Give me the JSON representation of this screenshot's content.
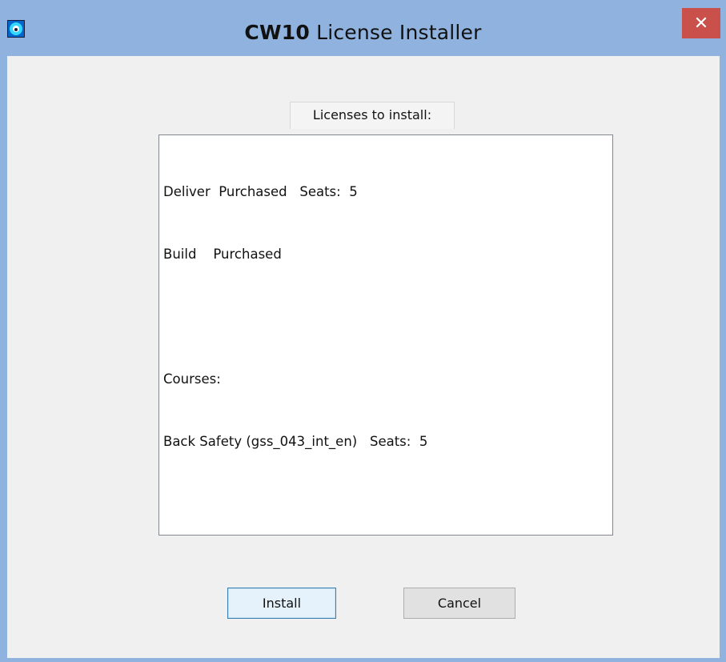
{
  "window": {
    "title_strong": "CW10",
    "title_rest": " License Installer",
    "close_glyph": "✕",
    "icon": "lock-icon"
  },
  "license_panel": {
    "caption": "Licenses to install:",
    "lines": [
      "Deliver  Purchased   Seats:  5",
      "Build    Purchased",
      "",
      "Courses:",
      "Back Safety (gss_043_int_en)   Seats:  5"
    ]
  },
  "buttons": {
    "install_label": "Install",
    "cancel_label": "Cancel"
  },
  "colors": {
    "titlebar": "#8fb2de",
    "close_button": "#c9504b",
    "client_background": "#f0f0f0"
  }
}
